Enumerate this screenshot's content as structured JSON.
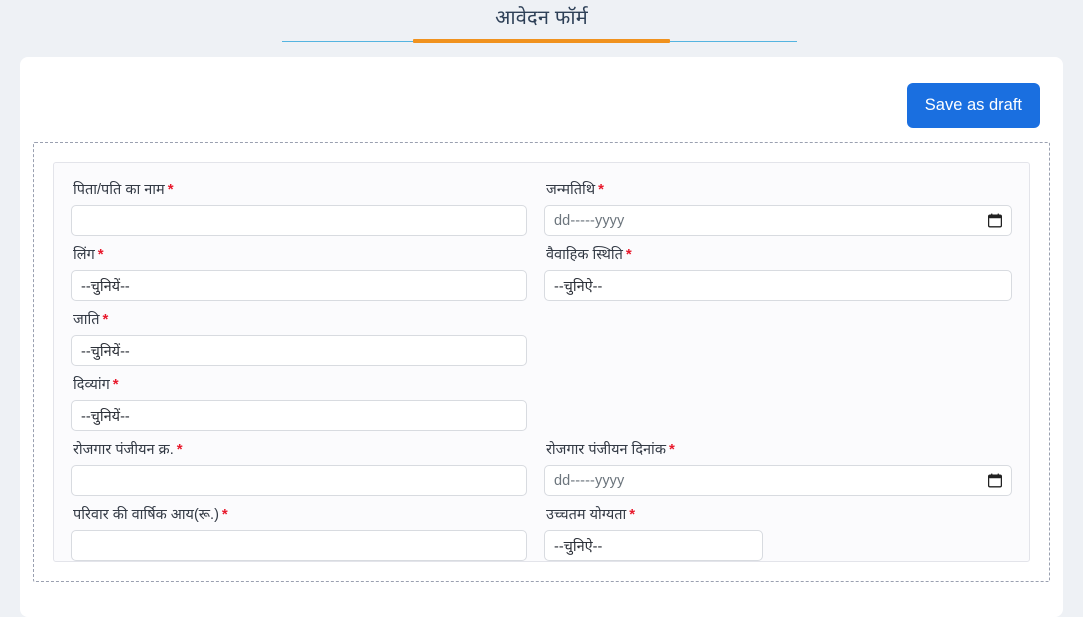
{
  "header": {
    "title": "आवेदन फॉर्म",
    "divider_line_color": "#54b4e0",
    "divider_accent_color": "#f0921e"
  },
  "toolbar": {
    "save_draft_label": "Save as draft",
    "save_draft_color": "#1a6fe0"
  },
  "form": {
    "required_marker": "*",
    "date_placeholder": "dd-----yyyy",
    "calendar_icon": "calendar-icon",
    "select_placeholder_1": "--चुनियें--",
    "select_placeholder_2": "--चुनिऐ--",
    "fields": {
      "father_husband_name": {
        "label": "पिता/पति का नाम",
        "value": "",
        "type": "text"
      },
      "dob": {
        "label": "जन्मतिथि",
        "value": "",
        "type": "date"
      },
      "gender": {
        "label": "लिंग",
        "value": "--चुनियें--",
        "type": "select"
      },
      "marital_status": {
        "label": "वैवाहिक स्थिति",
        "value": "--चुनिऐ--",
        "type": "select"
      },
      "caste": {
        "label": "जाति",
        "value": "--चुनियें--",
        "type": "select"
      },
      "divyang": {
        "label": "दिव्यांग",
        "value": "--चुनियें--",
        "type": "select"
      },
      "employment_reg_no": {
        "label": "रोजगार पंजीयन क्र.",
        "value": "",
        "type": "text"
      },
      "employment_reg_date": {
        "label": "रोजगार पंजीयन दिनांक",
        "value": "",
        "type": "date"
      },
      "family_annual_income": {
        "label": "परिवार की वार्षिक आय(रू.)",
        "value": "",
        "type": "text"
      },
      "highest_qualification": {
        "label": "उच्चतम योग्यता",
        "value": "--चुनिऐ--",
        "type": "select"
      }
    }
  }
}
